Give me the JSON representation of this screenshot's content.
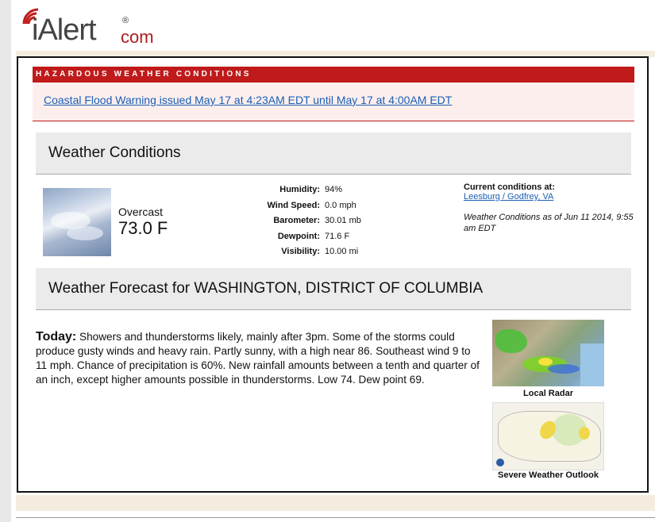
{
  "logo": {
    "brand": "iAlert",
    "reg": "®",
    "dotcom": "com"
  },
  "alert": {
    "header": "HAZARDOUS WEATHER CONDITIONS",
    "link": "Coastal Flood Warning issued May 17 at 4:23AM EDT until May 17 at 4:00AM EDT"
  },
  "conditions": {
    "section_title": "Weather Conditions",
    "description": "Overcast",
    "temperature": "73.0 F",
    "stats": [
      {
        "label": "Humidity:",
        "value": "94%"
      },
      {
        "label": "Wind Speed:",
        "value": "0.0 mph"
      },
      {
        "label": "Barometer:",
        "value": "30.01 mb"
      },
      {
        "label": "Dewpoint:",
        "value": "71.6 F"
      },
      {
        "label": "Visibility:",
        "value": "10.00 mi"
      }
    ],
    "current_heading": "Current conditions at:",
    "location_link": "Leesburg / Godfrey, VA",
    "as_of": "Weather Conditions as of Jun 11 2014, 9:55 am EDT"
  },
  "forecast": {
    "section_title": "Weather Forecast for WASHINGTON, DISTRICT OF COLUMBIA",
    "day": "Today:",
    "text": " Showers and thunderstorms likely, mainly after 3pm. Some of the storms could produce gusty winds and heavy rain. Partly sunny, with a high near 86. Southeast wind 9 to 11 mph. Chance of precipitation is 60%. New rainfall amounts between a tenth and quarter of an inch, except higher amounts possible in thunderstorms. Low 74. Dew point 69."
  },
  "sidebar": {
    "radar_caption": "Local Radar",
    "outlook_caption": "Severe Weather Outlook"
  },
  "colors": {
    "alert_red": "#c01a1a",
    "link_blue": "#1a5fb4",
    "brand_red": "#b01c1c"
  }
}
